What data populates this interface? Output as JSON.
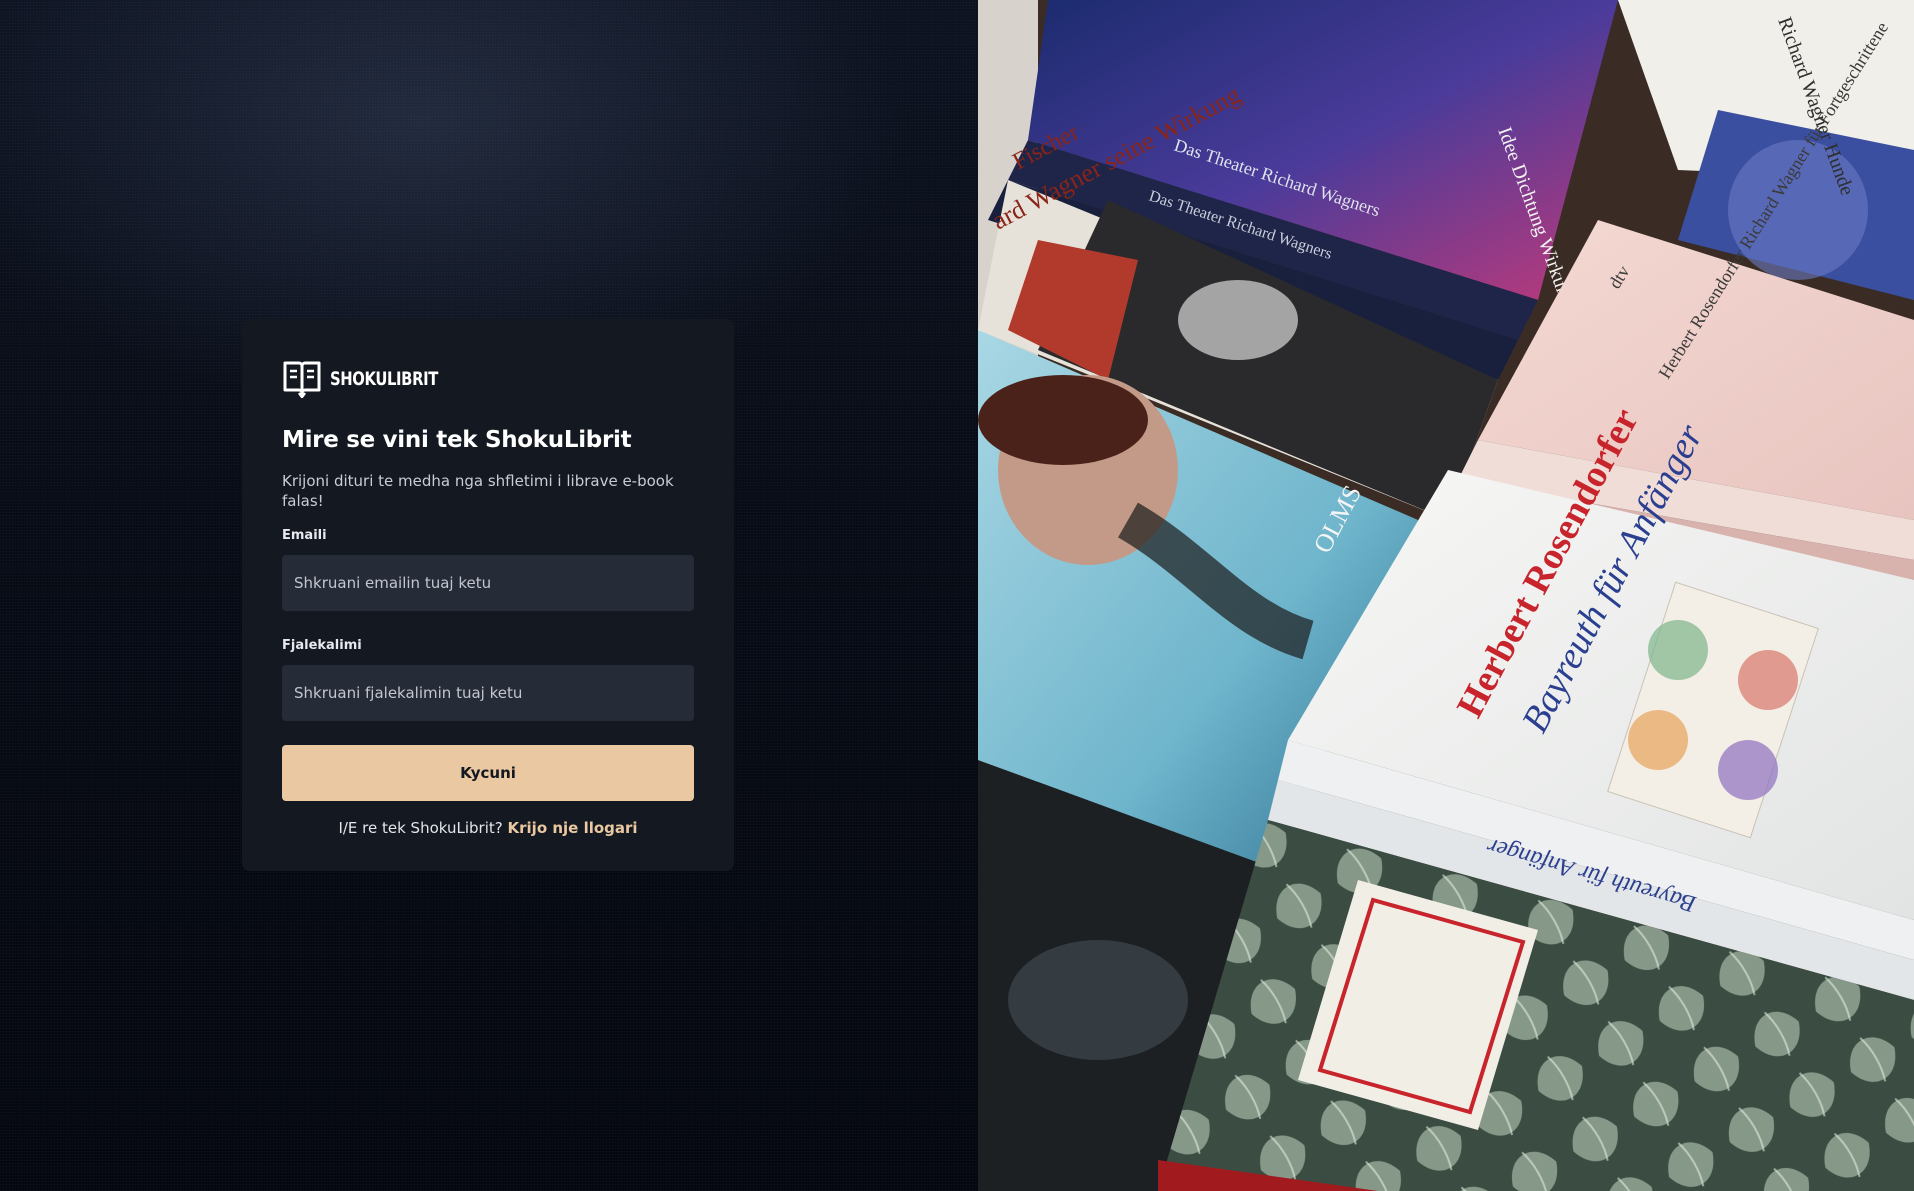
{
  "brand": {
    "name": "SHOKULIBRIT",
    "icon": "open-book-icon",
    "accent_color": "#eac8a2",
    "card_color": "#141821",
    "input_color": "#262b38"
  },
  "login": {
    "title": "Mire se vini tek ShokuLibrit",
    "subtitle": "Krijoni dituri te medha nga shfletimi i librave e-book falas!",
    "email_label": "Emaili",
    "email_placeholder": "Shkruani emailin tuaj ketu",
    "password_label": "Fjalekalimi",
    "password_placeholder": "Shkruani fjalekalimin tuaj ketu",
    "submit_label": "Kycuni",
    "signup_prompt": "I/E re tek ShokuLibrit?",
    "signup_link": "Krijo nje llogari"
  },
  "hero_image": {
    "description_icon": "books-photo",
    "book_texts": {
      "top_spine_1": "Das Theater Richard Wagners",
      "top_spine_2": "Das Theater Richard Wagners",
      "cover_top": "Idee Dichtung Wirkung",
      "left_cover": "ard Wagner seine Wirkung",
      "left_author": "Fischer",
      "olms": "OLMS",
      "pink_publisher": "dtv",
      "pink_title": "Herbert Rosendorfer Richard Wagner für Fortgeschrittene",
      "white_author": "Herbert Rosendorfer",
      "white_title": "Bayreuth für Anfänger",
      "white_spine": "Bayreuth für Anfänger",
      "top_right": "Richard Wagner Hunde"
    }
  }
}
